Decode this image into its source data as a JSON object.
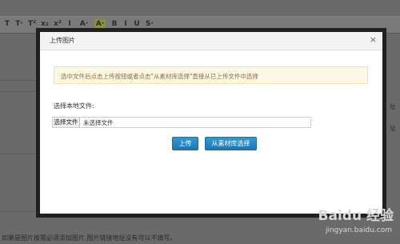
{
  "background": {
    "toolbar_buttons": [
      "T",
      "T·",
      "T²",
      "x₂",
      "x²",
      "I",
      "A·",
      "A·",
      "B",
      "I",
      "U",
      "S·"
    ],
    "bottom_note": "如果是图片按需必须添加图片,图片链接地址没有可以不填写。",
    "right_labels": [
      "址",
      "址"
    ]
  },
  "dialog": {
    "title": "上传图片",
    "close_symbol": "×",
    "notice": "选中文件后点击上传按钮或者点击\"从素材库选择\"直接从已上传文件中选择",
    "select_label": "选择本地文件:",
    "file_button_label": "选择文件",
    "file_status": "未选择文件",
    "upload_button": "上传",
    "library_button": "从素材库选择"
  },
  "watermark": {
    "brand": "Baidu 经验",
    "url": "jingyan.baidu.com"
  },
  "colors": {
    "overlay": "#5f5f5f",
    "notice_bg": "#fdf8e3",
    "notice_text": "#8a6d3b",
    "button_blue": "#1b74b8"
  }
}
